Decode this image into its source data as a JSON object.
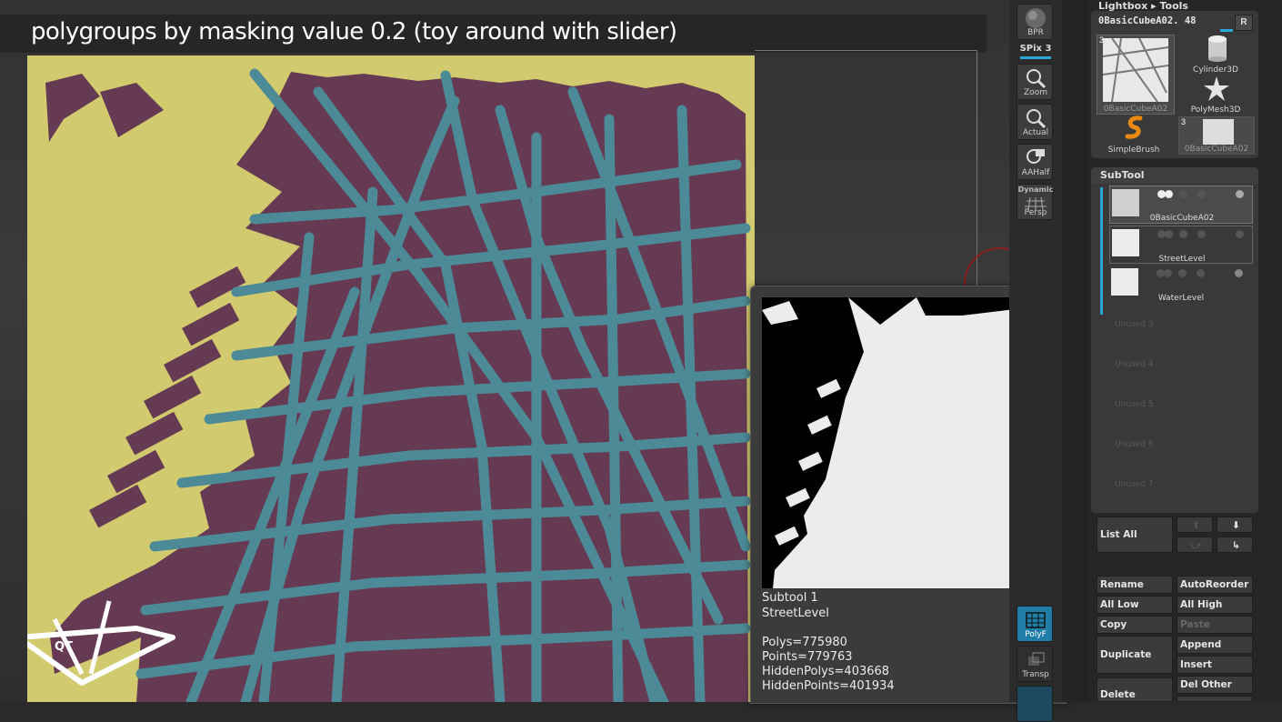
{
  "canvas": {
    "caption": "polygroups by masking value 0.2 (toy around with slider)",
    "logo_text": "QT"
  },
  "popup": {
    "subtool_index": "Subtool 1",
    "subtool_name": "StreetLevel",
    "polys": "Polys=775980",
    "points": "Points=779763",
    "hidden_polys": "HiddenPolys=403668",
    "hidden_points": "HiddenPoints=401934"
  },
  "shelf": {
    "bpr": "BPR",
    "spix": "SPix 3",
    "zoom": "Zoom",
    "actual": "Actual",
    "aahalf": "AAHalf",
    "dynamic": "Dynamic",
    "persp": "Persp",
    "polyf": "PolyF",
    "transp": "Transp"
  },
  "palette": {
    "breadcrumb_lightbox": "Lightbox",
    "breadcrumb_tools": "Tools",
    "current_tool": "0BasicCubeA02. 48",
    "r_button": "R",
    "tools": [
      {
        "label": "0BasicCubeA02",
        "badge": "3"
      },
      {
        "label": "Cylinder3D"
      },
      {
        "label": "PolyMesh3D"
      },
      {
        "label": "SimpleBrush"
      },
      {
        "label": "0BasicCubeA02",
        "badge": "3"
      }
    ],
    "subtool_header": "SubTool",
    "subtools": [
      "0BasicCubeA02",
      "StreetLevel",
      "WaterLevel"
    ],
    "unused": [
      "Unused 3",
      "Unused 4",
      "Unused 5",
      "Unused 6",
      "Unused 7"
    ],
    "buttons": {
      "list_all": "List All",
      "rename": "Rename",
      "auto_reorder": "AutoReorder",
      "all_low": "All Low",
      "all_high": "All High",
      "copy": "Copy",
      "paste": "Paste",
      "duplicate": "Duplicate",
      "append": "Append",
      "insert": "Insert",
      "delete": "Delete",
      "del_other": "Del Other"
    }
  },
  "colors": {
    "map_yellow": "#d2ca6e",
    "map_land": "#663a53",
    "map_street": "#4b8a96",
    "accent": "#2aa7d6"
  }
}
